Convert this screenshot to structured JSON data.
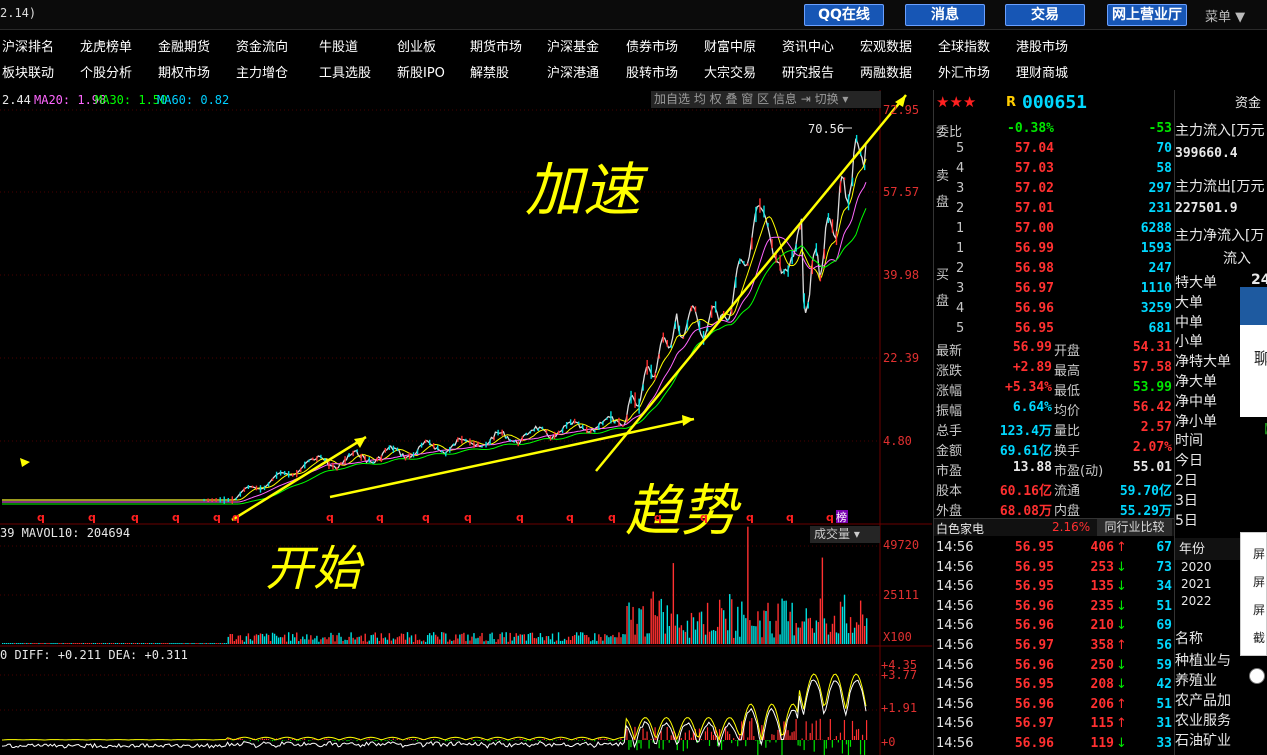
{
  "topbar": {
    "version": "2.14)",
    "qq": "QQ在线",
    "news": "消息",
    "trade": "交易",
    "online": "网上营业厅",
    "menu": "菜单 ▼"
  },
  "nav": {
    "row1": [
      "沪深排名",
      "龙虎榜单",
      "金融期货",
      "资金流向",
      "牛股道",
      "创业板",
      "期货市场",
      "沪深基金",
      "债券市场",
      "财富中原",
      "资讯中心",
      "宏观数据",
      "全球指数",
      "港股市场"
    ],
    "row2": [
      "板块联动",
      "个股分析",
      "期权市场",
      "主力增仓",
      "工具选股",
      "新股IPO",
      "解禁股",
      "沪深港通",
      "股转市场",
      "大宗交易",
      "研究报告",
      "两融数据",
      "外汇市场",
      "理财商城"
    ]
  },
  "ma": {
    "ma10": "2.44",
    "ma20": "MA20: 1.98",
    "ma30": "MA30: 1.50",
    "ma60": "MA60: 0.82"
  },
  "toolbar": "加自选 均 权 叠 窗 区 信息 ⇥ 切换 ▾",
  "price_axis": [
    "72.95",
    "57.57",
    "39.98",
    "22.39",
    "4.80"
  ],
  "peak_label": "70.56",
  "annotations": {
    "accel": "加速",
    "trend": "趋势",
    "rise": "开始"
  },
  "q_marks": [
    "q",
    "q",
    "q",
    "q",
    "q",
    "q",
    "q",
    "q",
    "q",
    "q",
    "q",
    "q",
    "q",
    "q",
    "q",
    "q",
    "q",
    "q"
  ],
  "bang": "榜",
  "vol": {
    "header": "39 MAVOL10: 204694",
    "button": "成交量 ▾",
    "axis": [
      "49720",
      "25111",
      "X100"
    ]
  },
  "macd": {
    "header": "0  DIFF: +0.211  DEA: +0.311",
    "axis": [
      "+4.35",
      "+3.77",
      "+1.91",
      "+0"
    ]
  },
  "quote": {
    "stars": "★★★",
    "code_prefix": "R",
    "code": "000651",
    "wb": {
      "label": "委比",
      "pct": "-0.38%",
      "val": "-53"
    },
    "sell_label": "卖盘",
    "buy_label": "买盘",
    "sell": [
      [
        "5",
        "57.04",
        "70"
      ],
      [
        "4",
        "57.03",
        "58"
      ],
      [
        "3",
        "57.02",
        "297"
      ],
      [
        "2",
        "57.01",
        "231"
      ],
      [
        "1",
        "57.00",
        "6288"
      ]
    ],
    "buy": [
      [
        "1",
        "56.99",
        "1593"
      ],
      [
        "2",
        "56.98",
        "247"
      ],
      [
        "3",
        "56.97",
        "1110"
      ],
      [
        "4",
        "56.96",
        "3259"
      ],
      [
        "5",
        "56.95",
        "681"
      ]
    ],
    "stats": [
      [
        "最新",
        "56.99",
        "开盘",
        "54.31"
      ],
      [
        "涨跌",
        "+2.89",
        "最高",
        "57.58"
      ],
      [
        "涨幅",
        "+5.34%",
        "最低",
        "53.99"
      ],
      [
        "振幅",
        "6.64%",
        "均价",
        "56.42"
      ],
      [
        "总手",
        "123.4万",
        "量比",
        "2.57"
      ],
      [
        "金额",
        "69.61亿",
        "换手",
        "2.07%"
      ],
      [
        "市盈",
        "13.88",
        "市盈(动)",
        "55.01"
      ],
      [
        "股本",
        "60.16亿",
        "流通",
        "59.70亿"
      ],
      [
        "外盘",
        "68.08万",
        "内盘",
        "55.29万"
      ]
    ],
    "name": "白色家电",
    "name_pct": "2.16%",
    "compare": "同行业比较",
    "ticks": [
      [
        "14:56",
        "56.95",
        "406",
        "↑",
        "67"
      ],
      [
        "14:56",
        "56.95",
        "253",
        "↓",
        "73"
      ],
      [
        "14:56",
        "56.95",
        "135",
        "↓",
        "34"
      ],
      [
        "14:56",
        "56.96",
        "235",
        "↓",
        "51"
      ],
      [
        "14:56",
        "56.96",
        "210",
        "↓",
        "69"
      ],
      [
        "14:56",
        "56.97",
        "358",
        "↑",
        "56"
      ],
      [
        "14:56",
        "56.96",
        "250",
        "↓",
        "59"
      ],
      [
        "14:56",
        "56.95",
        "208",
        "↓",
        "42"
      ],
      [
        "14:56",
        "56.96",
        "206",
        "↑",
        "51"
      ],
      [
        "14:56",
        "56.97",
        "115",
        "↑",
        "31"
      ],
      [
        "14:56",
        "56.96",
        "119",
        "↓",
        "33"
      ]
    ]
  },
  "fund": {
    "head": "资金",
    "inflow_label": "主力流入[万元",
    "inflow": "399660.4",
    "outflow_label": "主力流出[万元",
    "outflow": "227501.9",
    "net_label": "主力净流入[万",
    "flow_label": "流入",
    "flow_val": "24",
    "rows": [
      "特大单",
      "大单",
      "中单",
      "小单",
      "净特大单",
      "净大单",
      "净中单",
      "净小单",
      "时间",
      "今日",
      "2日",
      "3日",
      "5日"
    ],
    "year_label": "年份",
    "years": [
      "2020",
      "2021",
      "2022"
    ],
    "sector_label": "名称",
    "sectors": [
      "种植业与",
      "养殖业",
      "农产品加",
      "农业服务",
      "石油矿业"
    ]
  },
  "popup": {
    "text": "聊",
    "icon": "【"
  },
  "context_menu": [
    "屏",
    "屏",
    "屏",
    "截"
  ]
}
